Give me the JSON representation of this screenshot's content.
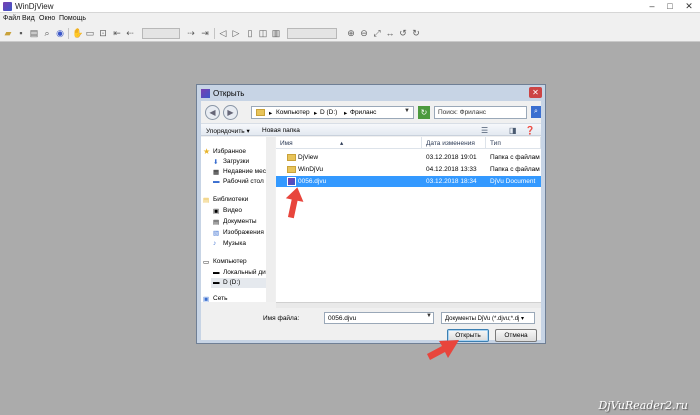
{
  "app": {
    "title": "WinDjView"
  },
  "menu": [
    "Файл",
    "Вид",
    "Окно",
    "Помощь"
  ],
  "dialog": {
    "title": "Открыть",
    "breadcrumbs": [
      "Компьютер",
      "D (D:)",
      "Фриланс"
    ],
    "search_placeholder": "Поиск: Фриланс",
    "commands": {
      "organize": "Упорядочить ▾",
      "new_folder": "Новая папка"
    },
    "nav": {
      "favorites": {
        "label": "Избранное",
        "items": [
          "Загрузки",
          "Недавние мес",
          "Рабочий стол"
        ]
      },
      "libraries": {
        "label": "Библиотеки",
        "items": [
          "Видео",
          "Документы",
          "Изображения",
          "Музыка"
        ]
      },
      "computer": {
        "label": "Компьютер",
        "items": [
          "Локальный ди",
          "D (D:)"
        ]
      },
      "network": {
        "label": "Сеть"
      }
    },
    "columns": {
      "name": "Имя",
      "date": "Дата изменения",
      "type": "Тип"
    },
    "files": [
      {
        "name": "DjView",
        "date": "03.12.2018 19:01",
        "type": "Папка с файлами",
        "kind": "folder"
      },
      {
        "name": "WinDjVu",
        "date": "04.12.2018 13:33",
        "type": "Папка с файлами",
        "kind": "folder"
      },
      {
        "name": "0056.djvu",
        "date": "03.12.2018 18:34",
        "type": "DjVu Document",
        "kind": "djvu",
        "selected": true
      }
    ],
    "filename_label": "Имя файла:",
    "filename_value": "0056.djvu",
    "filetype_value": "Документы DjVu (*.djvu;*.dj ▾",
    "open_button": "Открыть",
    "cancel_button": "Отмена"
  },
  "watermark": "DjVuReader2.ru",
  "colors": {
    "selection": "#3399ff",
    "arrow": "#e8453c"
  }
}
